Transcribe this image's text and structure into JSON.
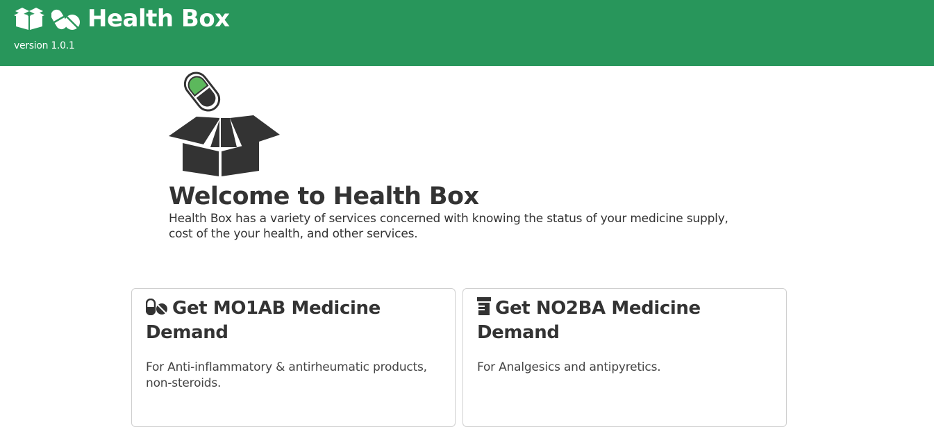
{
  "navbar": {
    "title": "Health Box",
    "version": "version 1.0.1",
    "icons": [
      "box-open-icon",
      "pills-icon"
    ],
    "background_color": "#28965b",
    "text_color": "#ffffff"
  },
  "hero": {
    "logo_icon": "pill-in-box-logo",
    "title": "Welcome to Health Box",
    "description": "Health Box has a variety of services concerned with knowing the status of your medicine supply, cost of the your health, and other services.",
    "logo_accent_color": "#5cb85c",
    "logo_dark_color": "#333333"
  },
  "cards": [
    {
      "icon": "pills-icon",
      "title": "Get MO1AB Medicine Demand",
      "description": "For Anti-inflammatory & antirheumatic products, non-steroids."
    },
    {
      "icon": "prescription-bottle-icon",
      "title": "Get NO2BA Medicine Demand",
      "description": "For Analgesics and antipyretics."
    }
  ]
}
